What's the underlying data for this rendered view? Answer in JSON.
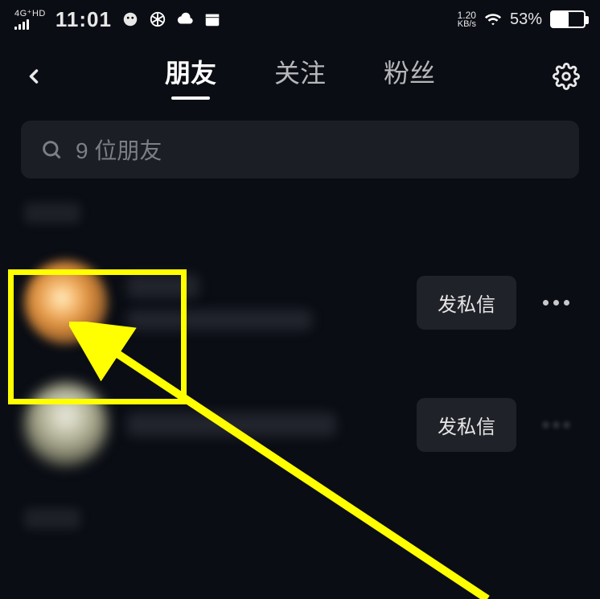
{
  "status_bar": {
    "network_label": "4G⁺HD",
    "time": "11:01",
    "net_speed_value": "1.20",
    "net_speed_unit": "KB/s",
    "battery_pct": "53%",
    "battery_fill_pct": 53
  },
  "header": {
    "tabs": [
      {
        "label": "朋友",
        "active": true
      },
      {
        "label": "关注",
        "active": false
      },
      {
        "label": "粉丝",
        "active": false
      }
    ]
  },
  "search": {
    "placeholder": "9 位朋友"
  },
  "friends": [
    {
      "dm_label": "发私信",
      "avatar_style": "orange",
      "show_more": true
    },
    {
      "dm_label": "发私信",
      "avatar_style": "grey",
      "show_more": true
    }
  ],
  "annotation": {
    "highlight_color": "#ffff00"
  }
}
